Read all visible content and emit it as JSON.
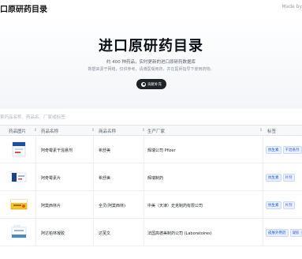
{
  "header": {
    "brand": "口原研药目录",
    "made_by": "Made by"
  },
  "hero": {
    "title": "进口原研药目录",
    "subtitle": "约 400 种药品，实时更新的进口原研药数据库",
    "note": "数据来源于网络，仅供参考，请遵医嘱用药，并在医师指导下使用药物。",
    "github_button": "贡献补充"
  },
  "search": {
    "placeholder": "索药品名称、药品名、厂家或标签"
  },
  "table": {
    "headers": {
      "image": "药品图片",
      "name": "药品名称",
      "brand": "商品名称",
      "maker": "生产厂家",
      "tags": "标签"
    },
    "rows": [
      {
        "name": "阿奇霉素干混悬剂",
        "brand": "希舒美",
        "maker": "辉瑞公司 Pfizer",
        "tags": [
          "抗生素",
          "干混悬剂"
        ],
        "thumb": "blue-white-box"
      },
      {
        "name": "阿奇霉素片",
        "brand": "希舒美",
        "maker": "辉瑞制药",
        "tags": [
          "抗生素",
          "片剂"
        ],
        "thumb": "blue-white-pack"
      },
      {
        "name": "阿莫西林片",
        "brand": "全灵(阿莫西林)",
        "maker": "中美（天津）史克制药有限公司",
        "tags": [
          "抗生素",
          "片剂"
        ],
        "thumb": "yellow-box"
      },
      {
        "name": "阿达帕林凝胶",
        "brand": "达芙文",
        "maker": "法国高德美制药公司 (Laboratoires)",
        "tags": [
          "皮肤外用药",
          "凝胶"
        ],
        "thumb": "white-blue-tube"
      }
    ]
  },
  "colors": {
    "accent": "#1a56db",
    "dark_button": "#1f2328"
  }
}
